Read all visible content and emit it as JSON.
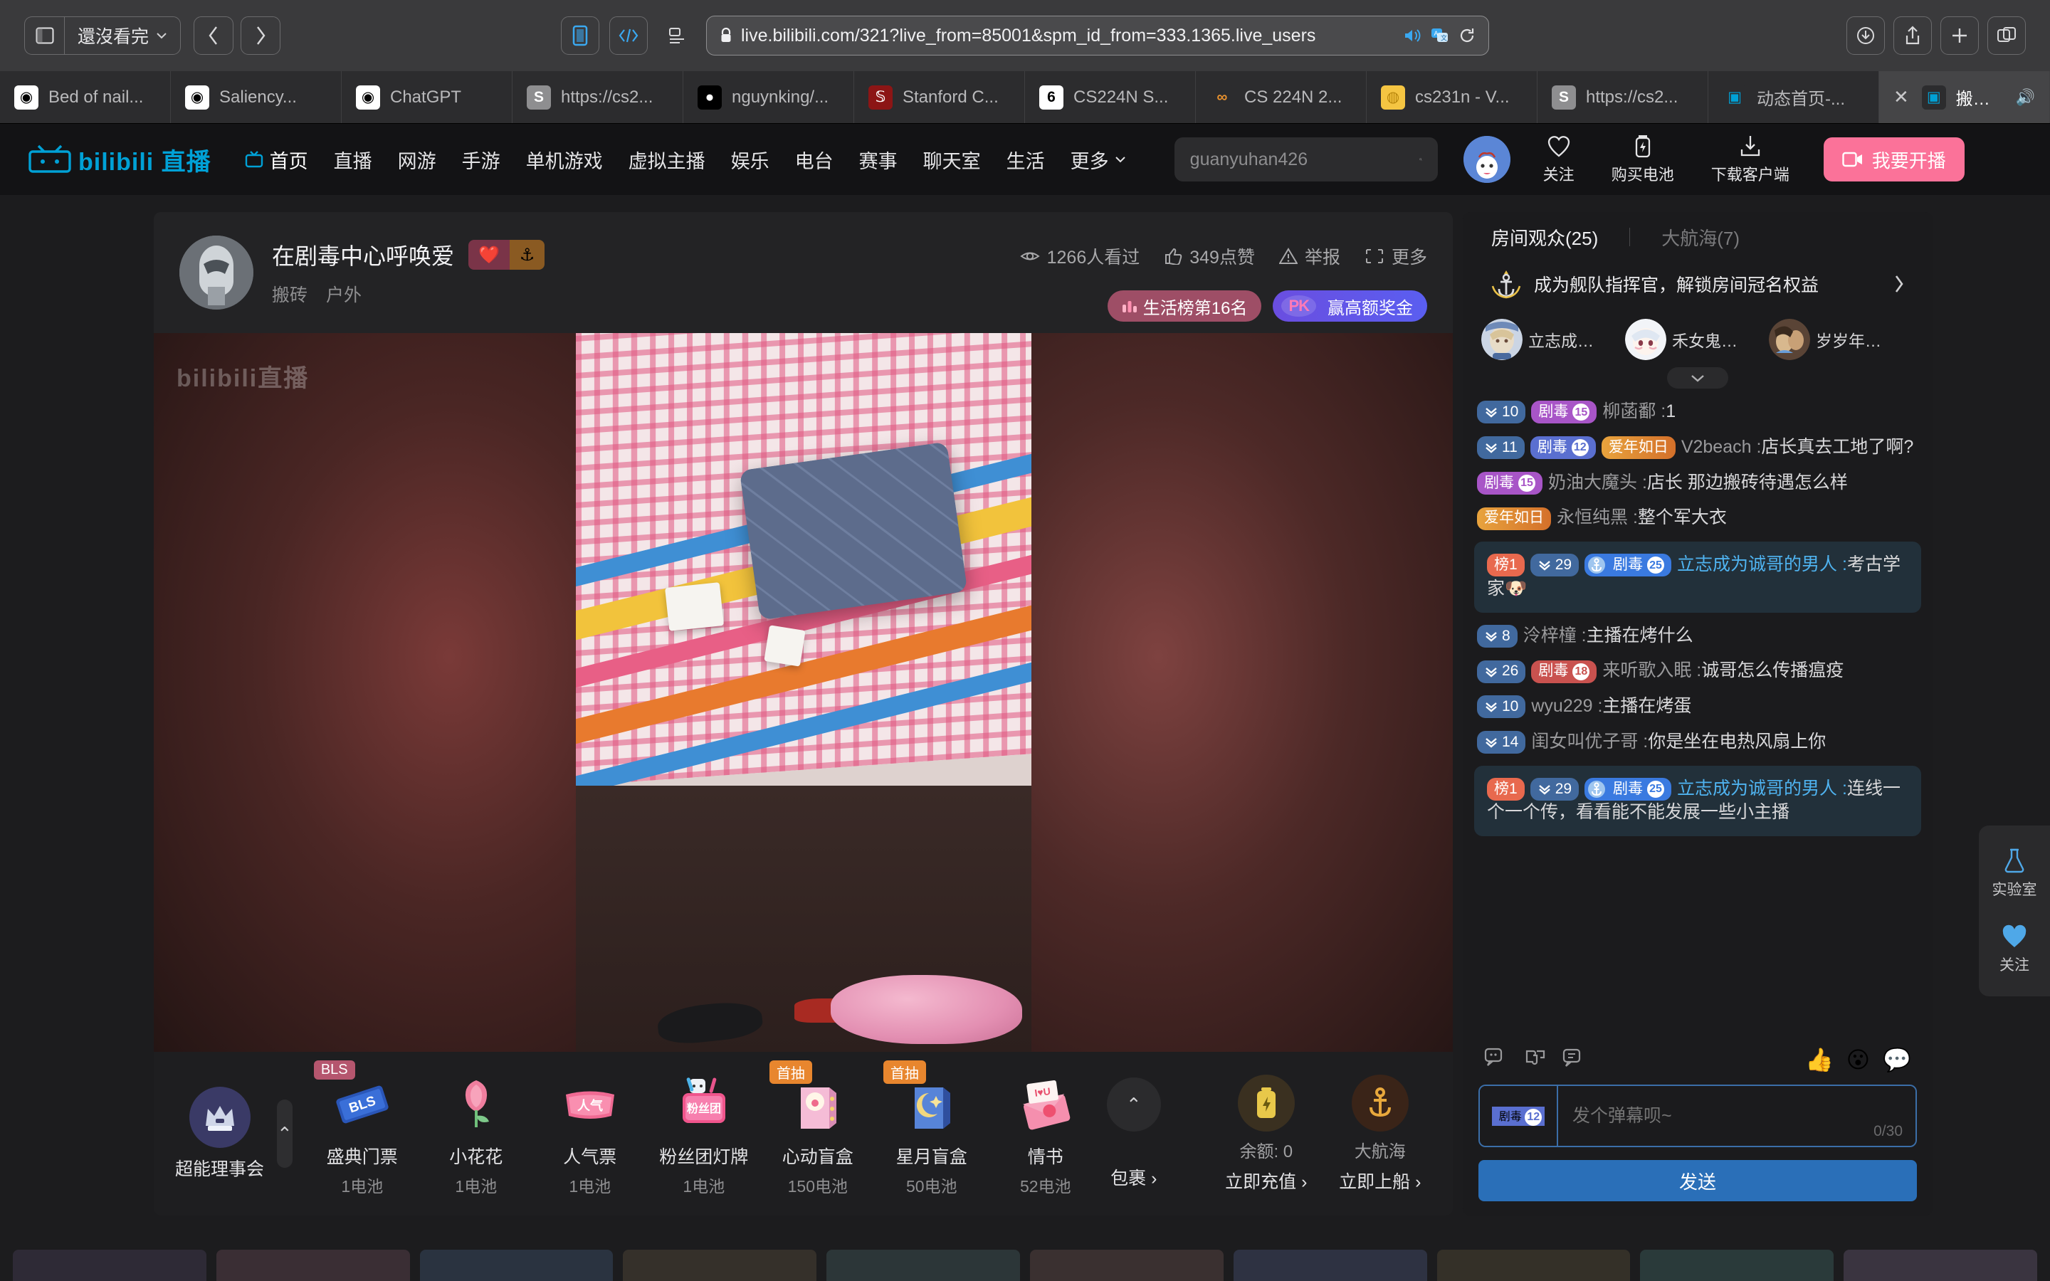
{
  "browser": {
    "sidebar_label": "還沒看完",
    "url": "live.bilibili.com/321?live_from=85001&spm_id_from=333.1365.live_users",
    "icons": {
      "sidebar": "sidebar-icon",
      "chevron_down": "chevron-down-icon",
      "back": "chevron-left-icon",
      "forward": "chevron-right-icon",
      "reader": "reader-icon",
      "code": "code-icon",
      "list": "list-icon",
      "lock": "lock-icon",
      "audio": "speaker-icon",
      "translate": "translate-icon",
      "reload": "reload-icon",
      "download": "download-icon",
      "share": "share-icon",
      "new_tab": "plus-icon",
      "tab_overview": "tab-overview-icon"
    },
    "tabs": [
      {
        "title": "Bed of nail...",
        "favicon": "openai",
        "active": false
      },
      {
        "title": "Saliency...",
        "favicon": "openai",
        "active": false
      },
      {
        "title": "ChatGPT",
        "favicon": "openai",
        "active": false
      },
      {
        "title": "https://cs2...",
        "favicon": "slides",
        "active": false
      },
      {
        "title": "nguynking/...",
        "favicon": "github",
        "active": false
      },
      {
        "title": "Stanford C...",
        "favicon": "stanford",
        "active": false
      },
      {
        "title": "CS224N S...",
        "favicon": "six",
        "active": false
      },
      {
        "title": "CS 224N 2...",
        "favicon": "colab",
        "active": false
      },
      {
        "title": "cs231n - V...",
        "favicon": "lemon",
        "active": false
      },
      {
        "title": "https://cs2...",
        "favicon": "slides",
        "active": false
      },
      {
        "title": "动态首页-...",
        "favicon": "bilibili",
        "active": false
      },
      {
        "title": "搬砖 -...",
        "favicon": "bilibili",
        "active": true
      }
    ]
  },
  "header": {
    "logo_text": "bilibili 直播",
    "nav": [
      {
        "label": "首页",
        "icon": "tv-icon"
      },
      {
        "label": "直播"
      },
      {
        "label": "网游"
      },
      {
        "label": "手游"
      },
      {
        "label": "单机游戏"
      },
      {
        "label": "虚拟主播"
      },
      {
        "label": "娱乐"
      },
      {
        "label": "电台"
      },
      {
        "label": "赛事"
      },
      {
        "label": "聊天室"
      },
      {
        "label": "生活"
      },
      {
        "label": "更多",
        "icon": "chevron-down-icon"
      }
    ],
    "search_value": "guanyuhan426",
    "search_placeholder": "guanyuhan426",
    "actions": [
      {
        "label": "关注",
        "icon": "heart-icon"
      },
      {
        "label": "购买电池",
        "icon": "battery-icon"
      },
      {
        "label": "下载客户端",
        "icon": "download-icon"
      }
    ],
    "go_live_label": "我要开播"
  },
  "room": {
    "title": "在剧毒中心呼唤爱",
    "tags": [
      "搬砖",
      "户外"
    ],
    "medal_left_icon": "heart-badge",
    "medal_right_icon": "anchor-badge",
    "stats": [
      {
        "label": "1266人看过",
        "icon": "eye-icon"
      },
      {
        "label": "349点赞",
        "icon": "thumbs-up-icon"
      },
      {
        "label": "举报",
        "icon": "warning-icon"
      },
      {
        "label": "更多",
        "icon": "more-icon"
      }
    ],
    "rank_badge": "生活榜第16名",
    "pk_badge": "赢高额奖金",
    "pk_icon_label": "PK",
    "watermark": "bilibili直播"
  },
  "gifts": {
    "council_label": "超能理事会",
    "items": [
      {
        "name": "盛典门票",
        "price": "1电池",
        "tag": "BLS",
        "tag_type": "bls",
        "art": "ticket"
      },
      {
        "name": "小花花",
        "price": "1电池",
        "tag": "",
        "tag_type": "",
        "art": "rose"
      },
      {
        "name": "人气票",
        "price": "1电池",
        "tag": "",
        "tag_type": "",
        "art": "popticket"
      },
      {
        "name": "粉丝团灯牌",
        "price": "1电池",
        "tag": "",
        "tag_type": "",
        "art": "fanboard"
      },
      {
        "name": "心动盲盒",
        "price": "150电池",
        "tag": "首抽",
        "tag_type": "first",
        "art": "pinkbox"
      },
      {
        "name": "星月盲盒",
        "price": "50电池",
        "tag": "首抽",
        "tag_type": "first",
        "art": "bluebox"
      },
      {
        "name": "情书",
        "price": "52电池",
        "tag": "",
        "tag_type": "",
        "art": "letter"
      }
    ],
    "pack_label": "包裹",
    "wallet": [
      {
        "label": "余额: 0",
        "action": "立即充值",
        "icon": "battery-icon",
        "color": "#e8c84a",
        "bg": "#3a3020"
      },
      {
        "label": "大航海",
        "action": "立即上船",
        "icon": "anchor-icon",
        "color": "#e8a83c",
        "bg": "#3a2418"
      }
    ]
  },
  "chat": {
    "tabs": [
      {
        "label": "房间观众(25)",
        "active": true
      },
      {
        "label": "大航海(7)",
        "active": false
      }
    ],
    "guard_banner": "成为舰队指挥官，解锁房间冠名权益",
    "guard_icon": "anchor-crown-icon",
    "viewers": [
      {
        "name": "立志成…"
      },
      {
        "name": "禾女鬼…"
      },
      {
        "name": "岁岁年…"
      }
    ],
    "expand_icon": "chevron-down-icon",
    "messages": [
      {
        "level": "10",
        "fans": {
          "name": "剧毒",
          "num": "15",
          "color": "#a855c7"
        },
        "user": "柳菡鄱",
        "text": "1",
        "highlight": false,
        "vip": false
      },
      {
        "level": "11",
        "fans": {
          "name": "剧毒",
          "num": "12",
          "color": "#5a6fd0"
        },
        "medal_img": "爱年如日",
        "user": "V2beach",
        "text": "店长真去工地了啊?",
        "highlight": false,
        "vip": false
      },
      {
        "level": "",
        "fans": {
          "name": "剧毒",
          "num": "15",
          "color": "#a855c7"
        },
        "user": "奶油大魔头",
        "text": "店长 那边搬砖待遇怎么样",
        "highlight": false,
        "vip": false
      },
      {
        "level": "",
        "medal_img": "爱年如日",
        "user": "永恒纯黑",
        "text": "整个军大衣",
        "highlight": false,
        "vip": false
      },
      {
        "rank": "榜1",
        "level": "29",
        "fans": {
          "name": "剧毒",
          "num": "25",
          "color": "#3a7ae0"
        },
        "guard": true,
        "user": "立志成为诚哥的男人",
        "text": "考古学家🐶",
        "highlight": true,
        "vip": true
      },
      {
        "level": "8",
        "user": "泠梓橦",
        "text": "主播在烤什么",
        "highlight": false,
        "vip": false
      },
      {
        "level": "26",
        "fans": {
          "name": "剧毒",
          "num": "18",
          "color": "#c9524f"
        },
        "user": "来听歌入眠",
        "text": "诚哥怎么传播瘟疫",
        "highlight": false,
        "vip": false
      },
      {
        "level": "10",
        "user": "wyu229",
        "text": "主播在烤蛋",
        "highlight": false,
        "vip": false
      },
      {
        "level": "14",
        "user": "闺女叫优子哥",
        "text": "你是坐在电热风扇上你",
        "highlight": false,
        "vip": false
      },
      {
        "rank": "榜1",
        "level": "29",
        "fans": {
          "name": "剧毒",
          "num": "25",
          "color": "#3a7ae0"
        },
        "guard": true,
        "user": "立志成为诚哥的男人",
        "text": "连线一个一个传，看看能不能发展一些小主播",
        "highlight": true,
        "vip": true
      }
    ],
    "toolbar_icons": [
      "emoji-panel-icon",
      "gift-puzzle-icon",
      "lottery-icon"
    ],
    "quick_emojis": [
      "👍",
      "😮",
      "💬"
    ],
    "input_medal": {
      "name": "剧毒",
      "num": "12"
    },
    "input_placeholder": "发个弹幕呗~",
    "input_counter": "0/30",
    "send_label": "发送"
  },
  "rail": [
    {
      "label": "实验室",
      "icon": "lab-icon"
    },
    {
      "label": "关注",
      "icon": "heart-icon"
    }
  ],
  "colors": {
    "brand_pink": "#fb7299",
    "brand_blue": "#00a1d6",
    "chat_highlight": "#22303a",
    "send_button": "#2a6fb8"
  }
}
